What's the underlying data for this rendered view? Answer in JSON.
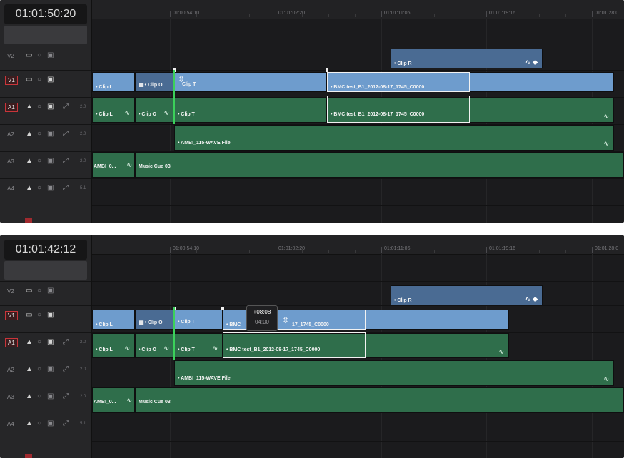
{
  "ruler_labels": [
    "01:00:54:10",
    "01:01:02:20",
    "01:01:11:06",
    "01:01:19:16",
    "01:01:28:0"
  ],
  "tracks": [
    {
      "name": "V2",
      "kind": "video",
      "selected": false
    },
    {
      "name": "V1",
      "kind": "video",
      "selected": true
    },
    {
      "name": "A1",
      "kind": "audio",
      "selected": true,
      "channels": "2.0"
    },
    {
      "name": "A2",
      "kind": "audio",
      "selected": false,
      "channels": "2.0"
    },
    {
      "name": "A3",
      "kind": "audio",
      "selected": false,
      "channels": "2.0"
    },
    {
      "name": "A4",
      "kind": "audio",
      "selected": false,
      "channels": "5.1"
    }
  ],
  "icons": {
    "monitor": "▭",
    "lock": "🔒",
    "auto_select": "▣",
    "speaker": "🔈",
    "expand": "⤢",
    "fade": "∿",
    "keyframe": "◆",
    "cursor": "⇳"
  },
  "colors": {
    "video_clip": "#6e9ccd",
    "audio_clip": "#2f6e4b",
    "playhead": "#3bd15a",
    "selection_border": "#f2f2f2"
  },
  "panels": [
    {
      "timecode": "01:01:50:20",
      "clips": {
        "clip_r": "• Clip R",
        "v1_clip_l": "• Clip L",
        "v1_clip_o": "• Clip O",
        "v1_clip_t": "Clip T",
        "v1_bmc": "• BMC test_B1_2012-08-17_1745_C0000",
        "a1_clip_l": "• Clip L",
        "a1_clip_o": "• Clip O",
        "a1_clip_t": "• Clip T",
        "a1_bmc": "• BMC test_B1_2012-08-17_1745_C0000",
        "a2_ambi": "• AMBI_115-WAVE File",
        "a3_ambi": "AMBI_0...",
        "a3_music": "Music Cue 03"
      }
    },
    {
      "timecode": "01:01:42:12",
      "clips": {
        "clip_r": "• Clip R",
        "v1_clip_l": "• Clip L",
        "v1_clip_o": "• Clip O",
        "v1_clip_t": "• Clip T",
        "v1_bmc_a": "• BMC",
        "v1_bmc_b": "17_1745_C0000",
        "a1_clip_l": "• Clip L",
        "a1_clip_o": "• Clip O",
        "a1_clip_t": "• Clip T",
        "a1_bmc": "• BMC test_B1_2012-08-17_1745_C0000",
        "a2_ambi": "• AMBI_115-WAVE File",
        "a3_ambi": "AMBI_0...",
        "a3_music": "Music Cue 03"
      },
      "tooltip": {
        "offset": "+08:08",
        "duration": "04:00"
      }
    }
  ]
}
